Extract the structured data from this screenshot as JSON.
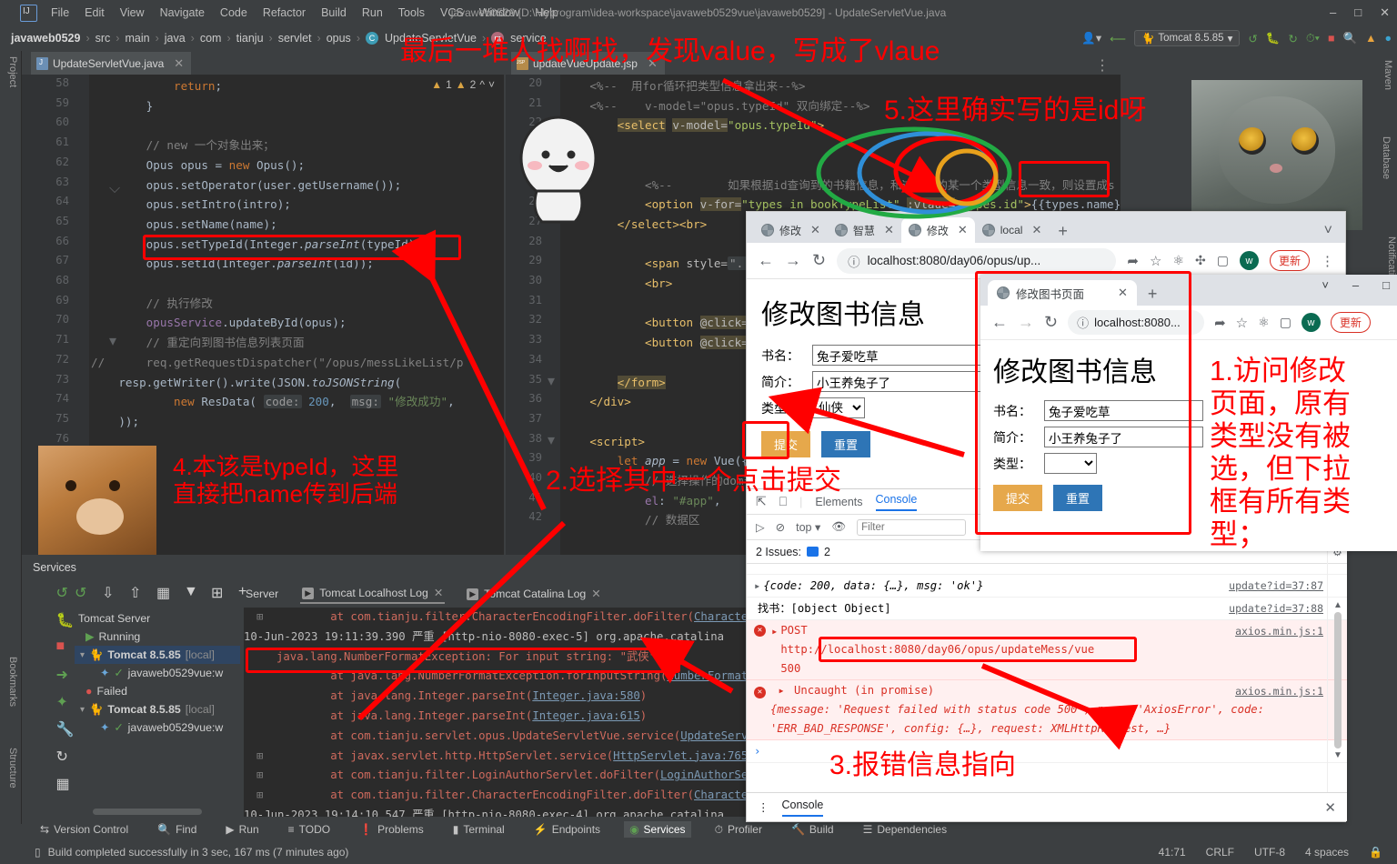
{
  "ide": {
    "app_title": "javaweb0529 [D:\\Myprogram\\idea-workspace\\javaweb0529vue\\javaweb0529] - UpdateServletVue.java",
    "menu": [
      "File",
      "Edit",
      "View",
      "Navigate",
      "Code",
      "Refactor",
      "Build",
      "Run",
      "Tools",
      "VCS",
      "Window",
      "Help"
    ],
    "breadcrumb": [
      "javaweb0529",
      "src",
      "main",
      "java",
      "com",
      "tianju",
      "servlet",
      "opus",
      "UpdateServletVue",
      "service"
    ],
    "run_config": "Tomcat 8.5.85",
    "left_strip": [
      "Project",
      "Bookmarks",
      "Structure"
    ],
    "right_strip": [
      "Maven",
      "Database",
      "Notifications"
    ],
    "tab_java": "UpdateServletVue.java",
    "tab_jsp": "updateVueUpdate.jsp",
    "warnings": {
      "warn1": "1",
      "warn2": "2"
    },
    "caret": "41:71",
    "line_sep": "CRLF",
    "encoding": "UTF-8",
    "indent": "4 spaces",
    "build_status": "Build completed successfully in 3 sec, 167 ms (7 minutes ago)",
    "toolwindows": [
      "Version Control",
      "Find",
      "Run",
      "TODO",
      "Problems",
      "Terminal",
      "Endpoints",
      "Services",
      "Profiler",
      "Build",
      "Dependencies"
    ],
    "active_toolwindow": "Services"
  },
  "editor_java": {
    "lines": [
      {
        "n": "58",
        "text": "        return;"
      },
      {
        "n": "59",
        "text": "    }"
      },
      {
        "n": "60",
        "text": ""
      },
      {
        "n": "61",
        "text": "    // new 一个对象出来；"
      },
      {
        "n": "62",
        "text": "    Opus opus = new Opus();"
      },
      {
        "n": "63",
        "text": "    opus.setOperator(user.getUsername());"
      },
      {
        "n": "64",
        "text": "    opus.setIntro(intro);"
      },
      {
        "n": "65",
        "text": "    opus.setName(name);"
      },
      {
        "n": "66",
        "text": "    opus.setTypeId(Integer.parseInt(typeId));"
      },
      {
        "n": "67",
        "text": "    opus.setId(Integer.parseInt(id));"
      },
      {
        "n": "68",
        "text": ""
      },
      {
        "n": "69",
        "text": "    // 执行修改"
      },
      {
        "n": "70",
        "text": "    opusService.updateById(opus);"
      },
      {
        "n": "71",
        "text": "    // 重定向到图书信息列表页面"
      },
      {
        "n": "72",
        "text": "//      req.getRequestDispatcher(\"/opus/messLikeList/p"
      },
      {
        "n": "73",
        "text": "    resp.getWriter().write(JSON.toJSONString("
      },
      {
        "n": "74",
        "text": "            new ResData( code: 200,  msg: \"修改成功\","
      },
      {
        "n": "75",
        "text": "    ));"
      },
      {
        "n": "76",
        "text": ""
      }
    ]
  },
  "editor_jsp": {
    "lines": [
      {
        "n": "20",
        "text": "<%--  用for循环把类型信息拿出来--%>"
      },
      {
        "n": "21",
        "text": "<%--    v-model=\"opus.typeId\" 双向绑定--%>"
      },
      {
        "n": "22",
        "text": "    <select v-model=\"opus.typeId\">"
      },
      {
        "n": "23",
        "text": ""
      },
      {
        "n": "24",
        "text": ""
      },
      {
        "n": "25",
        "text": "        <%--        如果根据id查询到的书籍信息，和这里拉的某一个类型信息一致，则设置成s"
      },
      {
        "n": "26",
        "text": "        <option v-for=\"types in bookTypeList\" :vlaue=\"types.id\">{{types.name}}<"
      },
      {
        "n": "27",
        "text": "    </select><br>"
      },
      {
        "n": "28",
        "text": ""
      },
      {
        "n": "29",
        "text": "        <span style=\"...\""
      },
      {
        "n": "30",
        "text": "        <br>"
      },
      {
        "n": "31",
        "text": ""
      },
      {
        "n": "32",
        "text": "        <button @click=\"u"
      },
      {
        "n": "33",
        "text": "        <button @click=\"r"
      },
      {
        "n": "34",
        "text": ""
      },
      {
        "n": "35",
        "text": "    </form>"
      },
      {
        "n": "36",
        "text": "</div>"
      },
      {
        "n": "37",
        "text": ""
      },
      {
        "n": "38",
        "text": "<script>"
      },
      {
        "n": "39",
        "text": "    let app = new Vue({"
      },
      {
        "n": "40",
        "text": "        // 选择操作的dom节点"
      },
      {
        "n": "41",
        "text": "        el: \"#app\","
      },
      {
        "n": "42",
        "text": "        // 数据区"
      }
    ]
  },
  "services": {
    "title": "Services",
    "tree": [
      {
        "label": "Tomcat Server",
        "kind": "root"
      },
      {
        "label": "Running",
        "kind": "status-run"
      },
      {
        "label": "Tomcat 8.5.85",
        "suffix": "[local]",
        "kind": "server",
        "selected": true
      },
      {
        "label": "javaweb0529vue:w",
        "kind": "artifact"
      },
      {
        "label": "Failed",
        "kind": "status-fail"
      },
      {
        "label": "Tomcat 8.5.85",
        "suffix": "[local]",
        "kind": "server"
      },
      {
        "label": "javaweb0529vue:w",
        "kind": "artifact"
      }
    ],
    "tabs": [
      "Server",
      "Tomcat Localhost Log",
      "Tomcat Catalina Log"
    ],
    "active_tab": "Tomcat Localhost Log",
    "log_lines": [
      {
        "t": "        at com.tianju.filter.CharacterEncodingFilter.doFilter(",
        "link": "Character"
      },
      {
        "t": "10-Jun-2023 19:11:39.390 严重 [http-nio-8080-exec-5] org.apache.catalina",
        "sys": true
      },
      {
        "t": "java.lang.NumberFormatException: For input string: \"武侠\"",
        "boxed": true
      },
      {
        "t": "        at java.lang.NumberFormatException.forInputString(",
        "link": "NumberFormatE"
      },
      {
        "t": "        at java.lang.Integer.parseInt(",
        "link": "Integer.java:580",
        "tail": ")"
      },
      {
        "t": "        at java.lang.Integer.parseInt(",
        "link": "Integer.java:615",
        "tail": ")"
      },
      {
        "t": "        at com.tianju.servlet.opus.UpdateServletVue.service(",
        "link": "UpdateServl"
      },
      {
        "t": "        at javax.servlet.http.HttpServlet.service(",
        "link": "HttpServlet.java:765",
        "tail": ")"
      },
      {
        "t": "        at com.tianju.filter.LoginAuthorServlet.doFilter(",
        "link": "LoginAuthorSer"
      },
      {
        "t": "        at com.tianju.filter.CharacterEncodingFilter.doFilter(",
        "link": "Character"
      }
    ]
  },
  "browser1": {
    "tabs": [
      {
        "title": "修改"
      },
      {
        "title": "智慧"
      },
      {
        "title": "修改",
        "active": true
      },
      {
        "title": "local"
      }
    ],
    "new_tab": "+",
    "url": "localhost:8080/day06/opus/up...",
    "page": {
      "title": "修改图书信息",
      "fields": [
        {
          "label": "书名：",
          "value": "兔子爱吃草",
          "type": "text"
        },
        {
          "label": "简介：",
          "value": "小王养兔子了",
          "type": "text"
        },
        {
          "label": "类型：",
          "value": "仙侠",
          "type": "select"
        }
      ],
      "submit": "提交",
      "reset": "重置"
    },
    "devtools": {
      "tabs": [
        "Elements",
        "Console"
      ],
      "active_tab": "Console",
      "context": "top",
      "filter_placeholder": "Filter",
      "issues_text": "2 Issues:",
      "issues_count": "2",
      "console_foot": "Console",
      "logs": [
        {
          "text": "{code: 200, data: {…}, msg: 'ok'}",
          "src": "update?id=37:87",
          "level": "log"
        },
        {
          "text": "找书：[object Object]",
          "src": "update?id=37:88",
          "level": "log"
        },
        {
          "text": "POST http://localhost:8080/day06/opus/updateMess/vue 500",
          "src": "axios.min.js:1",
          "level": "error"
        },
        {
          "text": "Uncaught (in promise)",
          "src": "axios.min.js:1",
          "level": "error"
        },
        {
          "text": "{message: 'Request failed with status code 500', name: 'AxiosError', code: 'ERR_BAD_RESPONSE', config: {…}, request: XMLHttpRequest, …}",
          "level": "error-detail"
        }
      ]
    }
  },
  "browser2": {
    "tab_title": "修改图书页面",
    "url": "localhost:8080...",
    "update_pill": "更新",
    "profile_initial": "w",
    "page": {
      "title": "修改图书信息",
      "fields": [
        {
          "label": "书名：",
          "value": "兔子爱吃草",
          "type": "text"
        },
        {
          "label": "简介：",
          "value": "小王养兔子了",
          "type": "text"
        },
        {
          "label": "类型：",
          "value": "",
          "type": "select"
        }
      ],
      "submit": "提交",
      "reset": "重置"
    }
  },
  "annotations": [
    {
      "id": "top-note",
      "text": "最后一堆人找啊找，发现value，写成了vlaue"
    },
    {
      "id": "note-5",
      "text": "5.这里确实写的是id呀"
    },
    {
      "id": "note-1",
      "text": "1.访问修改\n页面，原有\n类型没有被\n选，但下拉\n框有所有类\n型；"
    },
    {
      "id": "note-2",
      "text": "2.选择其中一个点击提交"
    },
    {
      "id": "note-3",
      "text": "3.报错信息指向"
    },
    {
      "id": "note-4",
      "text": "4.本该是typeId，这里\n直接把name传到后端"
    }
  ],
  "colors": {
    "annotation_red": "#ff0000",
    "ide_bg": "#3c3f41",
    "editor_bg": "#2b2b2b",
    "accent_blue": "#1a73e8",
    "error_red": "#d93025",
    "submit_orange": "#e6a84b",
    "reset_blue": "#2e75b6"
  }
}
